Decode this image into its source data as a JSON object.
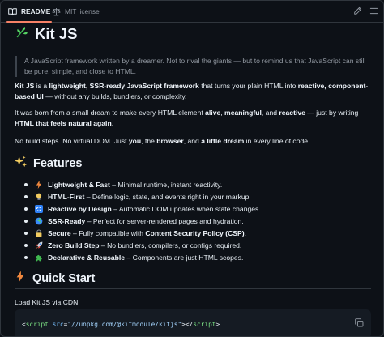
{
  "tabs": [
    {
      "label": "README",
      "icon": "book-icon",
      "active": true
    },
    {
      "label": "MIT license",
      "icon": "scale-icon",
      "active": false
    }
  ],
  "toolbar": {
    "edit_icon": "pencil-icon",
    "menu_icon": "list-icon"
  },
  "title": {
    "emoji": "herb-icon",
    "text": "Kit JS"
  },
  "quote": "A JavaScript framework written by a dreamer. Not to rival the giants — but to remind us that JavaScript can still be pure, simple, and close to HTML.",
  "intro": {
    "p1": {
      "a": "Kit JS",
      "b": " is a ",
      "c": "lightweight, SSR-ready JavaScript framework",
      "d": " that turns your plain HTML into ",
      "e": "reactive, component-based UI",
      "f": " — without any builds, bundlers, or complexity."
    },
    "p2": {
      "a": "It was born from a small dream to make every HTML element ",
      "b": "alive",
      "c": ", ",
      "d": "meaningful",
      "e": ", and ",
      "f": "reactive",
      "g": " — just by writing ",
      "h": "HTML that feels natural again",
      "i": "."
    },
    "p3": {
      "a": "No build steps. No virtual DOM. Just ",
      "b": "you",
      "c": ", the ",
      "d": "browser",
      "e": ", and ",
      "f": "a little dream",
      "g": " in every line of code."
    }
  },
  "features": {
    "heading": "Features",
    "heading_icon": "sparkles-icon",
    "items": [
      {
        "icon": "lightning-icon",
        "bold": "Lightweight & Fast",
        "rest": " – Minimal runtime, instant reactivity."
      },
      {
        "icon": "lightbulb-icon",
        "bold": "HTML-First",
        "rest": " – Define logic, state, and events right in your markup."
      },
      {
        "icon": "refresh-icon",
        "bold": "Reactive by Design",
        "rest": " – Automatic DOM updates when state changes."
      },
      {
        "icon": "globe-icon",
        "bold": "SSR-Ready",
        "rest": " – Perfect for server-rendered pages and hydration."
      },
      {
        "icon": "lock-icon",
        "bold": "Secure",
        "rest": " – Fully compatible with ",
        "bold2": "Content Security Policy (CSP)",
        "rest2": "."
      },
      {
        "icon": "rocket-icon",
        "bold": "Zero Build Step",
        "rest": " – No bundlers, compilers, or configs required."
      },
      {
        "icon": "puzzle-icon",
        "bold": "Declarative & Reusable",
        "rest": " – Components are just HTML scopes."
      }
    ]
  },
  "quickstart": {
    "heading": "Quick Start",
    "heading_icon": "lightning-icon",
    "load_text": "Load Kit JS via CDN:",
    "code": {
      "open_lt": "<",
      "tag": "script",
      "attr": "src",
      "eq": "=",
      "value": "\"//unpkg.com/@kitmodule/kitjs\"",
      "close_gt": "></",
      "tag_close": "script",
      "end": ">"
    },
    "copy_icon": "copy-icon"
  },
  "colors": {
    "background": "#0d1117",
    "accent": "#f78166",
    "border": "#30363d",
    "muted": "#9198a1"
  }
}
